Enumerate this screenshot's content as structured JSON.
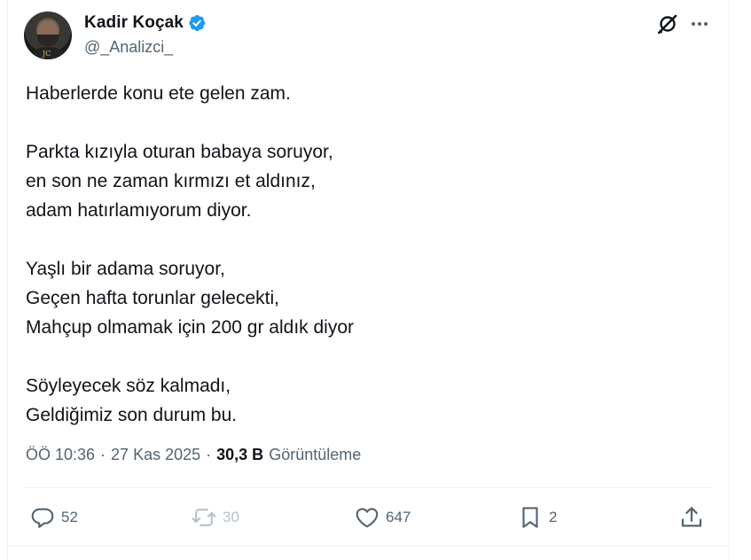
{
  "author": {
    "display_name": "Kadir Koçak",
    "handle": "@_Analizci_",
    "verified": true,
    "avatar_text": "JC"
  },
  "header": {
    "grok_icon": "grok-icon",
    "more_icon": "more-horizontal-icon"
  },
  "tweet": {
    "text": "Haberlerde konu ete gelen zam.\n\nParkta kızıyla oturan babaya soruyor,\nen son ne zaman kırmızı et aldınız,\nadam hatırlamıyorum diyor.\n\nYaşlı bir adama soruyor,\nGeçen hafta torunlar gelecekti,\nMahçup olmamak için 200 gr aldık diyor\n\nSöyleyecek söz kalmadı,\nGeldiğimiz son durum bu."
  },
  "meta": {
    "time": "ÖÖ 10:36",
    "date": "27 Kas 2025",
    "separator": "·",
    "views_count": "30,3 B",
    "views_label": "Görüntüleme"
  },
  "actions": {
    "replies": "52",
    "reposts": "30",
    "likes": "647",
    "bookmarks": "2"
  },
  "colors": {
    "text": "#0f1419",
    "secondary": "#536471",
    "verified": "#1d9bf0",
    "border": "#eff3f4"
  }
}
